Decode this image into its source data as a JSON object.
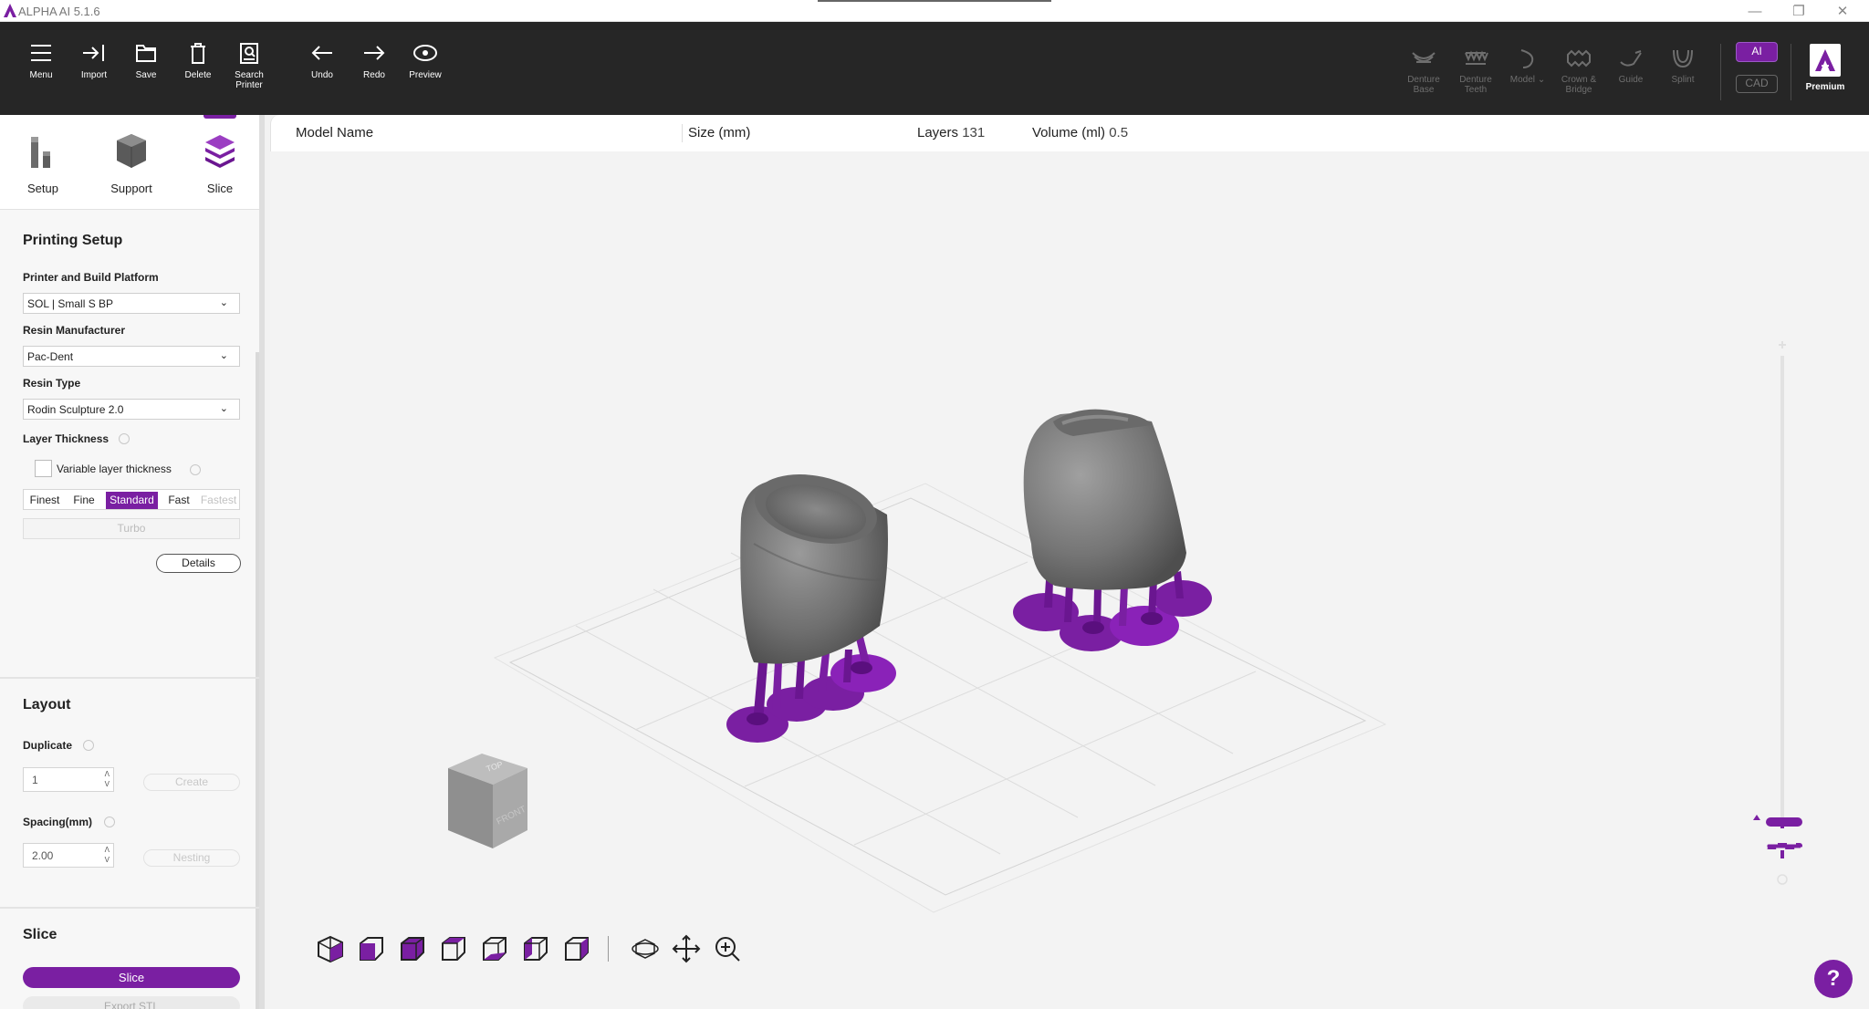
{
  "window": {
    "title": "ALPHA AI 5.1.6"
  },
  "toolbar": {
    "left": [
      {
        "label": "Menu",
        "icon": "menu-icon"
      },
      {
        "label": "Import",
        "icon": "import-icon"
      },
      {
        "label": "Save",
        "icon": "folder-icon"
      },
      {
        "label": "Delete",
        "icon": "trash-icon"
      },
      {
        "label": "Search\nPrinter",
        "icon": "search-printer-icon"
      },
      {
        "label": "Undo",
        "icon": "arrow-left-icon"
      },
      {
        "label": "Redo",
        "icon": "arrow-right-icon"
      },
      {
        "label": "Preview",
        "icon": "eye-icon"
      }
    ],
    "right": [
      {
        "label": "Denture\nBase",
        "icon": "denture-base-icon"
      },
      {
        "label": "Denture\nTeeth",
        "icon": "denture-teeth-icon"
      },
      {
        "label": "Model",
        "icon": "model-icon"
      },
      {
        "label": "Crown &\nBridge",
        "icon": "crown-bridge-icon"
      },
      {
        "label": "Guide",
        "icon": "guide-icon"
      },
      {
        "label": "Splint",
        "icon": "splint-icon"
      }
    ],
    "ai_label": "AI",
    "cad_label": "CAD",
    "premium_label": "Premium"
  },
  "tabs": [
    {
      "label": "Setup"
    },
    {
      "label": "Support"
    },
    {
      "label": "Slice"
    }
  ],
  "printing_setup": {
    "title": "Printing Setup",
    "printer_label": "Printer and Build Platform",
    "printer_value": "SOL | Small S BP",
    "resin_manufacturer_label": "Resin Manufacturer",
    "resin_manufacturer_value": "Pac-Dent",
    "resin_type_label": "Resin Type",
    "resin_type_value": "Rodin Sculpture 2.0",
    "layer_thickness_label": "Layer Thickness",
    "variable_label": "Variable layer thickness",
    "thickness_options": [
      "Finest",
      "Fine",
      "Standard",
      "Fast",
      "Fastest"
    ],
    "selected_thickness": "Standard",
    "turbo_label": "Turbo",
    "details_label": "Details"
  },
  "layout": {
    "title": "Layout",
    "duplicate_label": "Duplicate",
    "duplicate_value": "1",
    "create_label": "Create",
    "spacing_label": "Spacing(mm)",
    "spacing_value": "2.00",
    "nesting_label": "Nesting"
  },
  "slice": {
    "title": "Slice",
    "slice_button": "Slice",
    "export_button": "Export STL"
  },
  "infobar": {
    "model_name_label": "Model Name",
    "size_label": "Size (mm)",
    "layers_label": "Layers",
    "layers_value": "131",
    "volume_label": "Volume (ml)",
    "volume_value": "0.5"
  },
  "viewcube": {
    "top_label": "TOP",
    "front_label": "FRONT"
  },
  "help_label": "?",
  "colors": {
    "accent": "#7a1fa2",
    "toolbar_bg": "#262626"
  }
}
